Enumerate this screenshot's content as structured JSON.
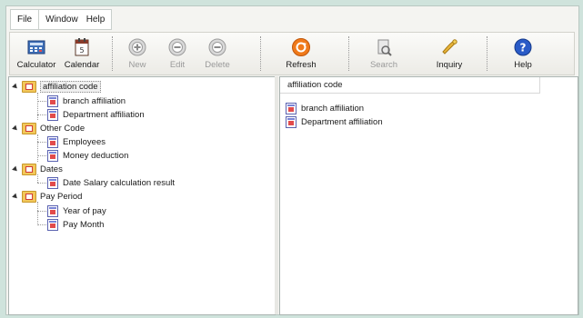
{
  "menu": {
    "items": [
      "File",
      "Window",
      "Help"
    ]
  },
  "toolbar": {
    "buttons": [
      {
        "label": "Calculator",
        "icon": "calculator-icon",
        "enabled": true
      },
      {
        "label": "Calendar",
        "icon": "calendar-icon",
        "enabled": true
      },
      {
        "label": "New",
        "icon": "new-icon",
        "enabled": false
      },
      {
        "label": "Edit",
        "icon": "edit-icon",
        "enabled": false
      },
      {
        "label": "Delete",
        "icon": "delete-icon",
        "enabled": false
      },
      {
        "label": "Refresh",
        "icon": "refresh-icon",
        "enabled": true
      },
      {
        "label": "Search",
        "icon": "search-icon",
        "enabled": false
      },
      {
        "label": "Inquiry",
        "icon": "inquiry-icon",
        "enabled": true
      },
      {
        "label": "Help",
        "icon": "help-icon",
        "enabled": true
      }
    ]
  },
  "tree": {
    "groups": [
      {
        "label": "affiliation code",
        "selected": true,
        "children": [
          "branch affiliation",
          "Department affiliation"
        ]
      },
      {
        "label": "Other Code",
        "selected": false,
        "children": [
          "Employees",
          "Money deduction"
        ]
      },
      {
        "label": "Dates",
        "selected": false,
        "children": [
          "Date Salary calculation result"
        ]
      },
      {
        "label": "Pay Period",
        "selected": false,
        "children": [
          "Year of pay",
          "Pay Month"
        ]
      }
    ]
  },
  "list": {
    "header": "affiliation code",
    "rows": [
      "branch affiliation",
      "Department affiliation"
    ]
  },
  "colors": {
    "background": "#cfe3dc",
    "refresh_accent": "#f07a1a",
    "help_accent": "#2a5bc7",
    "doc_accent": "#e24b4b"
  }
}
